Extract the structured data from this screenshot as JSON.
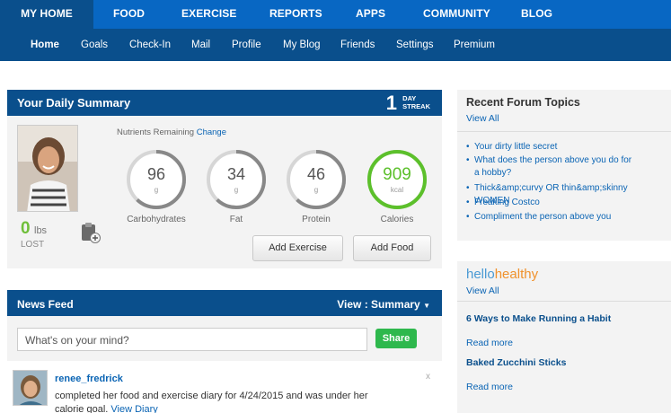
{
  "top_nav": [
    "MY HOME",
    "FOOD",
    "EXERCISE",
    "REPORTS",
    "APPS",
    "COMMUNITY",
    "BLOG"
  ],
  "sub_nav": [
    "Home",
    "Goals",
    "Check-In",
    "Mail",
    "Profile",
    "My Blog",
    "Friends",
    "Settings",
    "Premium"
  ],
  "daily_summary": {
    "title": "Your Daily Summary",
    "streak_number": "1",
    "streak_label_line1": "DAY",
    "streak_label_line2": "STREAK",
    "lost_value": "0",
    "lost_unit": "lbs",
    "lost_label": "LOST",
    "nutrients_label": "Nutrients Remaining",
    "change_link": "Change",
    "rings": [
      {
        "value": "96",
        "unit": "g",
        "label": "Carbohydrates",
        "color": "#888888"
      },
      {
        "value": "34",
        "unit": "g",
        "label": "Fat",
        "color": "#888888"
      },
      {
        "value": "46",
        "unit": "g",
        "label": "Protein",
        "color": "#888888"
      },
      {
        "value": "909",
        "unit": "kcal",
        "label": "Calories",
        "color": "#5cc02b"
      }
    ],
    "add_exercise_label": "Add Exercise",
    "add_food_label": "Add Food"
  },
  "news_feed": {
    "title": "News Feed",
    "view_label": "View : Summary",
    "input_placeholder": "What's on your mind?",
    "share_label": "Share",
    "post": {
      "user": "renee_fredrick",
      "close": "x",
      "text_line1": "completed her food and exercise diary for 4/24/2015 and was under her",
      "text_line2": "calorie goal.",
      "link": "View Diary"
    }
  },
  "forum": {
    "title": "Recent Forum Topics",
    "view_all": "View All",
    "topics": [
      "Your dirty little secret",
      "What does the person above you do for a hobby?",
      "Thick&amp;curvy OR thin&amp;skinny WOMEN",
      "Freaking Costco",
      "Compliment the person above you"
    ]
  },
  "hello_healthy": {
    "logo_hello": "hello",
    "logo_healthy": "healthy",
    "view_all": "View All",
    "articles": [
      {
        "title": "6 Ways to Make Running a Habit",
        "read_more": "Read more"
      },
      {
        "title": "Baked Zucchini Sticks",
        "read_more": "Read more"
      }
    ]
  },
  "colors": {
    "brand_blue": "#0867c3",
    "dark_blue": "#0a4f8c",
    "green": "#5cc02b",
    "link": "#0a64b4"
  }
}
